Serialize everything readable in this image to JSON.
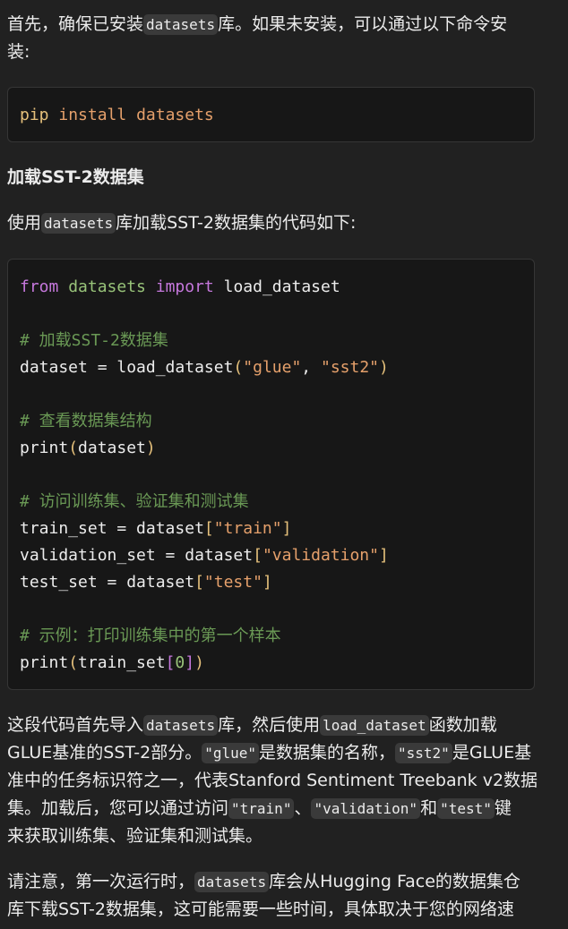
{
  "intro": {
    "line1_before": "首先，确保已安装",
    "line1_code": "datasets",
    "line1_after": "库。如果未安装，可以通过以下命令安",
    "line2": "装:"
  },
  "install_block": {
    "pip": "pip",
    "install": "install",
    "pkg": "datasets"
  },
  "heading": "加载SST-2数据集",
  "usage": {
    "before": "使用",
    "code": "datasets",
    "after": "库加载SST-2数据集的代码如下:"
  },
  "code": {
    "l1_from": "from",
    "l1_module": "datasets",
    "l1_import": "import",
    "l1_name": "load_dataset",
    "c1": "# 加载SST-2数据集",
    "l2_lhs": "dataset = load_dataset",
    "l2_open": "(",
    "l2_arg1": "\"glue\"",
    "l2_comma": ", ",
    "l2_arg2": "\"sst2\"",
    "l2_close": ")",
    "c2": "# 查看数据集结构",
    "l3_fn": "print",
    "l3_open": "(",
    "l3_arg": "dataset",
    "l3_close": ")",
    "c3": "# 访问训练集、验证集和测试集",
    "l4_lhs": "train_set = dataset",
    "l4_open": "[",
    "l4_key": "\"train\"",
    "l4_close": "]",
    "l5_lhs": "validation_set = dataset",
    "l5_open": "[",
    "l5_key": "\"validation\"",
    "l5_close": "]",
    "l6_lhs": "test_set = dataset",
    "l6_open": "[",
    "l6_key": "\"test\"",
    "l6_close": "]",
    "c4": "# 示例：打印训练集中的第一个样本",
    "l7_fn": "print",
    "l7_open": "(",
    "l7_arg": "train_set",
    "l7_iopen": "[",
    "l7_idx": "0",
    "l7_iclose": "]",
    "l7_close": ")"
  },
  "explain": {
    "l1_a": "这段代码首先导入",
    "l1_code1": "datasets",
    "l1_b": "库，然后使用",
    "l1_code2": "load_dataset",
    "l1_c": "函数加载",
    "l2_a": "GLUE基准的SST-2部分。",
    "l2_code1": "\"glue\"",
    "l2_b": "是数据集的名称，",
    "l2_code2": "\"sst2\"",
    "l2_c": "是GLUE基",
    "l3": "准中的任务标识符之一，代表Stanford Sentiment Treebank v2数据",
    "l4_a": "集。加载后，您可以通过访问",
    "l4_code1": "\"train\"",
    "l4_b": "、",
    "l4_code2": "\"validation\"",
    "l4_c": "和",
    "l4_code3": "\"test\"",
    "l4_d": "键",
    "l5": "来获取训练集、验证集和测试集。"
  },
  "note": {
    "l1_a": "请注意，第一次运行时，",
    "l1_code": "datasets",
    "l1_b": "库会从Hugging Face的数据集仓",
    "l2": "库下载SST-2数据集，这可能需要一些时间，具体取决于您的网络速"
  }
}
